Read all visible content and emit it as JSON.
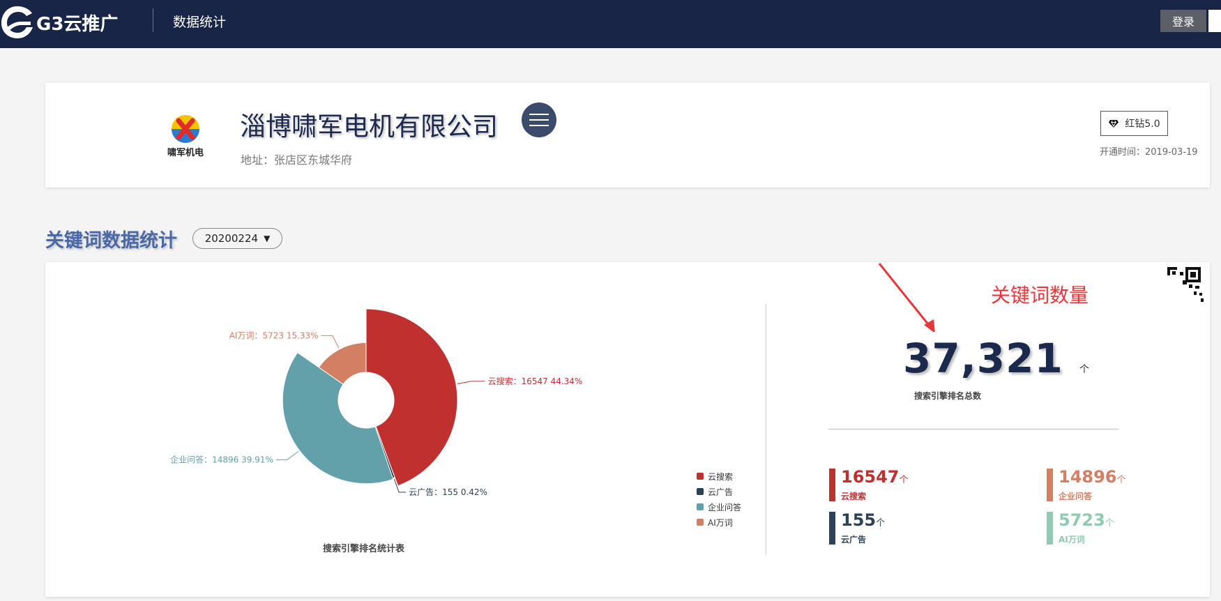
{
  "header": {
    "brand": "G3云推广",
    "page_title": "数据统计",
    "login_label": "登录"
  },
  "company": {
    "logo_text": "啸军机电",
    "name": "淄博啸军电机有限公司",
    "address": "地址：张店区东城华府",
    "tier": "红钻5.0",
    "open_date": "开通时间：2019-03-19"
  },
  "section": {
    "title": "关键词数据统计",
    "date_value": "20200224",
    "annotation": "关键词数量"
  },
  "summary": {
    "total": "37,321",
    "unit": "个",
    "total_label": "搜索引擎排名总数"
  },
  "colors": {
    "cloud_search": "#c0302e",
    "cloud_ad": "#2e4257",
    "qa": "#62a0aa",
    "ai": "#d27f63"
  },
  "stats": [
    {
      "value": "16547",
      "unit": "个",
      "label": "云搜索",
      "color": "#c0302e"
    },
    {
      "value": "14896",
      "unit": "个",
      "label": "企业问答",
      "color": "#d27f63"
    },
    {
      "value": "155",
      "unit": "个",
      "label": "云广告",
      "color": "#2e4257"
    },
    {
      "value": "5723",
      "unit": "个",
      "label": "AI万词",
      "color": "#8fcab1"
    }
  ],
  "chart_data": {
    "type": "pie",
    "title": "搜索引擎排名统计表",
    "categories": [
      "云搜索",
      "云广告",
      "企业问答",
      "AI万词"
    ],
    "values": [
      16547,
      155,
      14896,
      5723
    ],
    "percentages": [
      44.34,
      0.42,
      39.91,
      15.33
    ],
    "labels": [
      "云搜索：16547   44.34%",
      "云广告：155   0.42%",
      "企业问答：14896   39.91%",
      "AI万词：5723   15.33%"
    ],
    "colors": [
      "#c0302e",
      "#2e4257",
      "#62a0aa",
      "#d27f63"
    ],
    "rose": true,
    "legend": "right"
  }
}
